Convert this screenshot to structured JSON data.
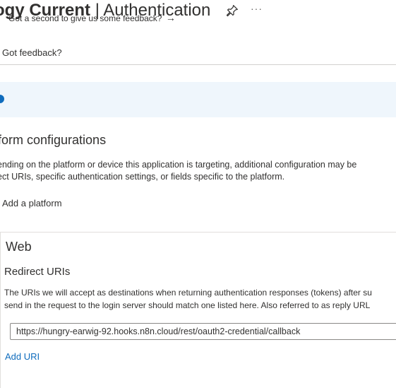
{
  "header": {
    "app_name": "ogy Current",
    "separator": "|",
    "page_title": "Authentication",
    "more_label": "···"
  },
  "toolbar": {
    "feedback_label": "Got feedback?"
  },
  "banner": {
    "text": "Got a second to give us some feedback?",
    "arrow": "→"
  },
  "platform_configurations": {
    "heading": "form configurations",
    "description_line1": "ending on the platform or device this application is targeting, additional configuration may be",
    "description_line2": "ect URIs, specific authentication settings, or fields specific to the platform.",
    "add_platform_label": "Add a platform"
  },
  "web": {
    "title": "Web",
    "redirect_heading": "Redirect URIs",
    "redirect_desc_line1": "The URIs we will accept as destinations when returning authentication responses (tokens) after su",
    "redirect_desc_line2": "send in the request to the login server should match one listed here. Also referred to as reply URL",
    "uris": [
      "https://hungry-earwig-92.hooks.n8n.cloud/rest/oauth2-credential/callback"
    ],
    "add_uri_label": "Add URI"
  },
  "icons": {
    "pin": "pin-icon",
    "more": "more-icon",
    "info": "info-icon"
  },
  "colors": {
    "accent": "#0f6cbd",
    "banner_bg": "#eff6fc",
    "text": "#323130"
  }
}
